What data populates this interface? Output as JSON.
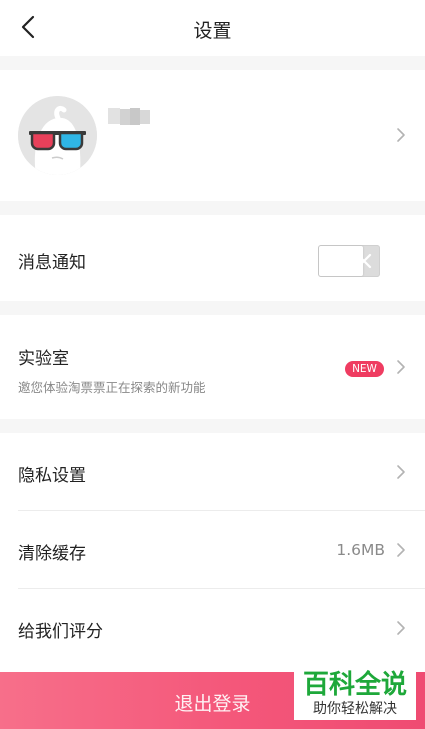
{
  "header": {
    "title": "设置"
  },
  "profile": {
    "avatar": "ghost-avatar-with-3d-glasses"
  },
  "notifications": {
    "label": "消息通知",
    "enabled": false
  },
  "lab": {
    "label": "实验室",
    "subtitle": "邀您体验淘票票正在探索的新功能",
    "badge": "NEW"
  },
  "privacy": {
    "label": "隐私设置"
  },
  "cache": {
    "label": "清除缓存",
    "value": "1.6MB"
  },
  "rate": {
    "label": "给我们评分"
  },
  "logout": {
    "label": "退出登录"
  },
  "watermark": {
    "line1": "百科全说",
    "line2": "助你轻松解决"
  },
  "colors": {
    "accent": "#ef3c61",
    "watermark_green": "#1ea83a"
  }
}
